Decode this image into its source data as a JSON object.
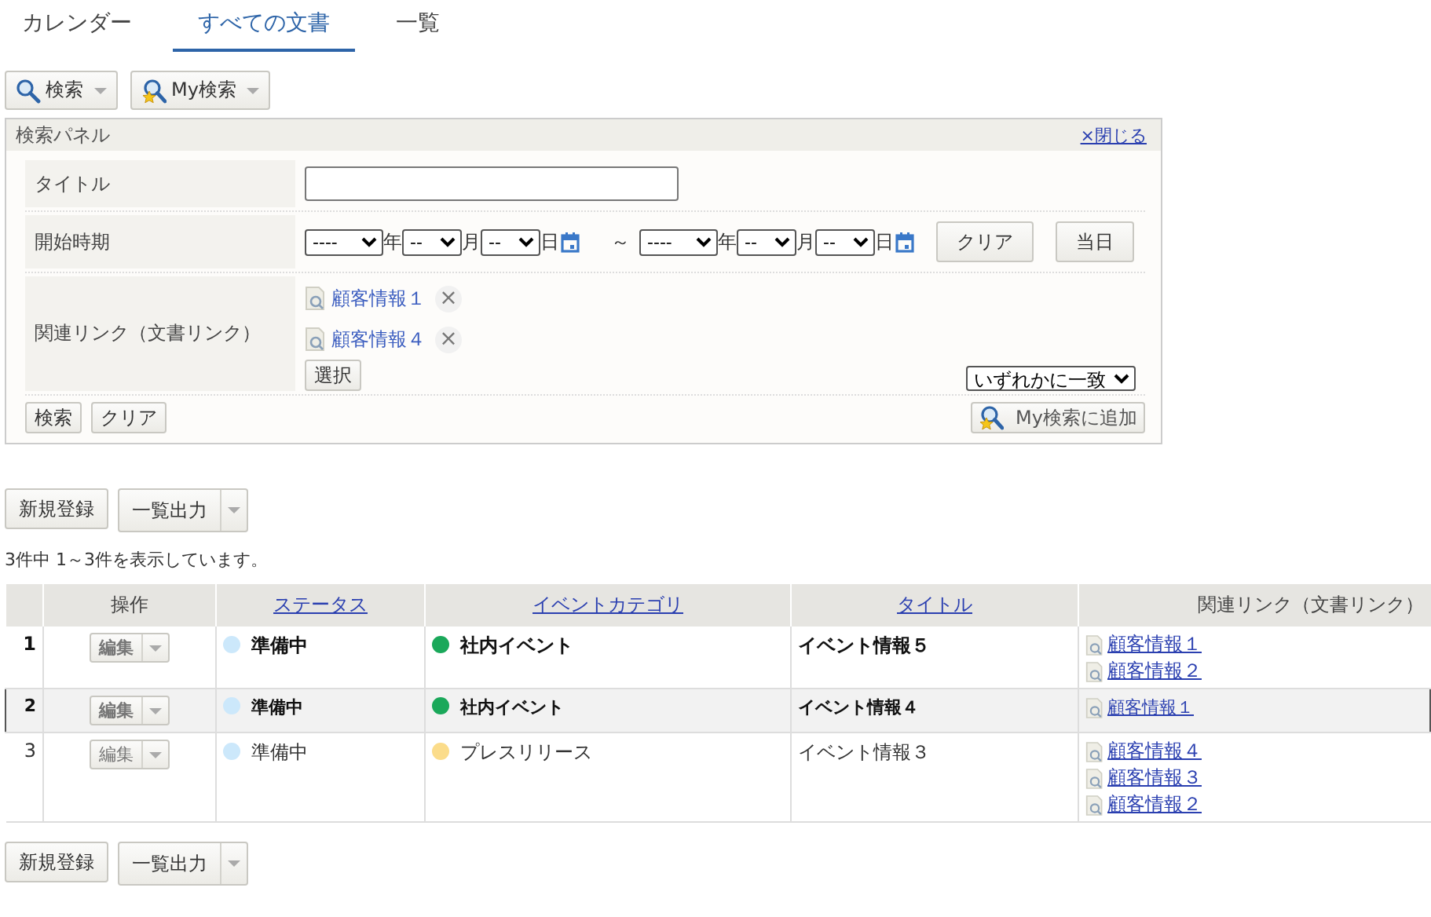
{
  "tabs": [
    {
      "label": "カレンダー",
      "selected": false
    },
    {
      "label": "すべての文書",
      "selected": true
    },
    {
      "label": "一覧",
      "selected": false
    }
  ],
  "toolbar": {
    "search_button": "検索",
    "my_search_button": "My検索"
  },
  "search_panel": {
    "title": "検索パネル",
    "close_link": "×閉じる",
    "title_field": {
      "label": "タイトル"
    },
    "start_period": {
      "label": "開始時期",
      "from": {
        "year": "----",
        "year_unit": "年",
        "month": "--",
        "month_unit": "月",
        "day": "--",
        "day_unit": "日"
      },
      "tilde": "～",
      "to": {
        "year": "----",
        "year_unit": "年",
        "month": "--",
        "month_unit": "月",
        "day": "--",
        "day_unit": "日"
      },
      "clear_button": "クリア",
      "today_button": "当日"
    },
    "related_links": {
      "label": "関連リンク（文書リンク）",
      "items": [
        "顧客情報１",
        "顧客情報４"
      ],
      "remove_mark": "×",
      "select_button": "選択",
      "match_mode": "いずれかに一致"
    },
    "search_button": "検索",
    "clear_button": "クリア",
    "add_my_search_button": "My検索に追加"
  },
  "actions": {
    "new_button": "新規登録",
    "export_button": "一覧出力"
  },
  "result_count": "3件中  1～3件を表示しています。",
  "table": {
    "columns": [
      {
        "label": "操作",
        "link": false
      },
      {
        "label": "ステータス",
        "link": true
      },
      {
        "label": "イベントカテゴリ",
        "link": true
      },
      {
        "label": "タイトル",
        "link": true
      },
      {
        "label": "関連リンク（文書リンク）",
        "link": false
      }
    ],
    "rows": [
      {
        "number": "1",
        "edit_button": "編集",
        "status": {
          "label": "準備中",
          "color": "#cce8fb"
        },
        "category": {
          "label": "社内イベント",
          "color": "#1aa85a"
        },
        "title": "イベント情報５",
        "links": [
          "顧客情報１",
          "顧客情報２"
        ],
        "unread": true,
        "selected": false
      },
      {
        "number": "2",
        "edit_button": "編集",
        "status": {
          "label": "準備中",
          "color": "#cce8fb"
        },
        "category": {
          "label": "社内イベント",
          "color": "#1aa85a"
        },
        "title": "イベント情報４",
        "links": [
          "顧客情報１"
        ],
        "unread": true,
        "selected": true
      },
      {
        "number": "3",
        "edit_button": "編集",
        "status": {
          "label": "準備中",
          "color": "#cce8fb"
        },
        "category": {
          "label": "プレスリリース",
          "color": "#fbdc8a"
        },
        "title": "イベント情報３",
        "links": [
          "顧客情報４",
          "顧客情報３",
          "顧客情報２"
        ],
        "unread": false,
        "selected": false
      }
    ]
  },
  "bottom_actions": {
    "new_button": "新規登録",
    "export_button": "一覧出力"
  }
}
